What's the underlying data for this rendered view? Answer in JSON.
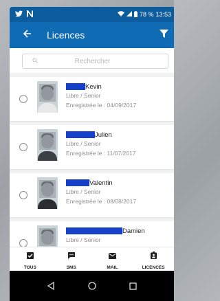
{
  "status_bar": {
    "left_icons": [
      "twitter-icon",
      "n-icon"
    ],
    "battery": "78 %",
    "time": "13:53"
  },
  "app_bar": {
    "title": "Licences"
  },
  "search": {
    "placeholder": "Rechercher"
  },
  "licences": [
    {
      "name": "Kevin",
      "category": "Libre / Senior",
      "registered": "Enregistrée le : 04/09/2017"
    },
    {
      "name": "Julien",
      "category": "Libre / Senior",
      "registered": "Enregistrée le : 11/07/2017"
    },
    {
      "name": "Valentin",
      "category": "Libre / Senior",
      "registered": "Enregistrée le : 08/08/2017"
    },
    {
      "name": "Damien",
      "category": "Libre / Senior",
      "registered": ""
    }
  ],
  "bottom_nav": [
    {
      "label": "TOUS",
      "icon": "checkbox-icon"
    },
    {
      "label": "SMS",
      "icon": "sms-icon"
    },
    {
      "label": "MAIL",
      "icon": "mail-icon"
    },
    {
      "label": "LICENCES",
      "icon": "badge-icon"
    }
  ],
  "colors": {
    "status_bar": "#0d5c9e",
    "app_bar": "#0f6bb4",
    "redaction": "#1640c9"
  }
}
